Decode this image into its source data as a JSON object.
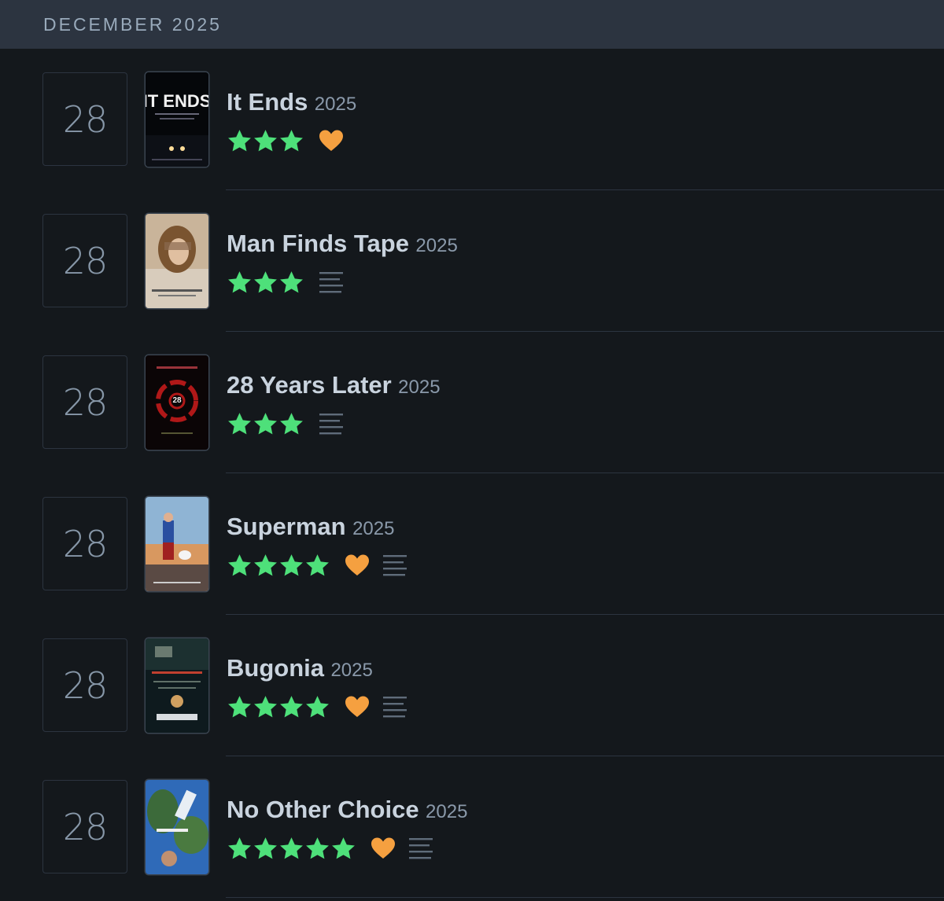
{
  "month_header": "DECEMBER 2025",
  "colors": {
    "star": "#40bcf4",
    "star_green": "#00e054",
    "heart": "#ff8000",
    "review_lines": "#678"
  },
  "entries": [
    {
      "day": "28",
      "title": "It Ends",
      "year": "2025",
      "rating_stars": 3,
      "liked": true,
      "has_review": false,
      "poster_icon": "poster-it-ends"
    },
    {
      "day": "28",
      "title": "Man Finds Tape",
      "year": "2025",
      "rating_stars": 3,
      "liked": false,
      "has_review": true,
      "poster_icon": "poster-man-finds-tape"
    },
    {
      "day": "28",
      "title": "28 Years Later",
      "year": "2025",
      "rating_stars": 3,
      "liked": false,
      "has_review": true,
      "poster_icon": "poster-28-years-later"
    },
    {
      "day": "28",
      "title": "Superman",
      "year": "2025",
      "rating_stars": 4,
      "liked": true,
      "has_review": true,
      "poster_icon": "poster-superman"
    },
    {
      "day": "28",
      "title": "Bugonia",
      "year": "2025",
      "rating_stars": 4,
      "liked": true,
      "has_review": true,
      "poster_icon": "poster-bugonia"
    },
    {
      "day": "28",
      "title": "No Other Choice",
      "year": "2025",
      "rating_stars": 5,
      "liked": true,
      "has_review": true,
      "poster_icon": "poster-no-other-choice"
    }
  ]
}
